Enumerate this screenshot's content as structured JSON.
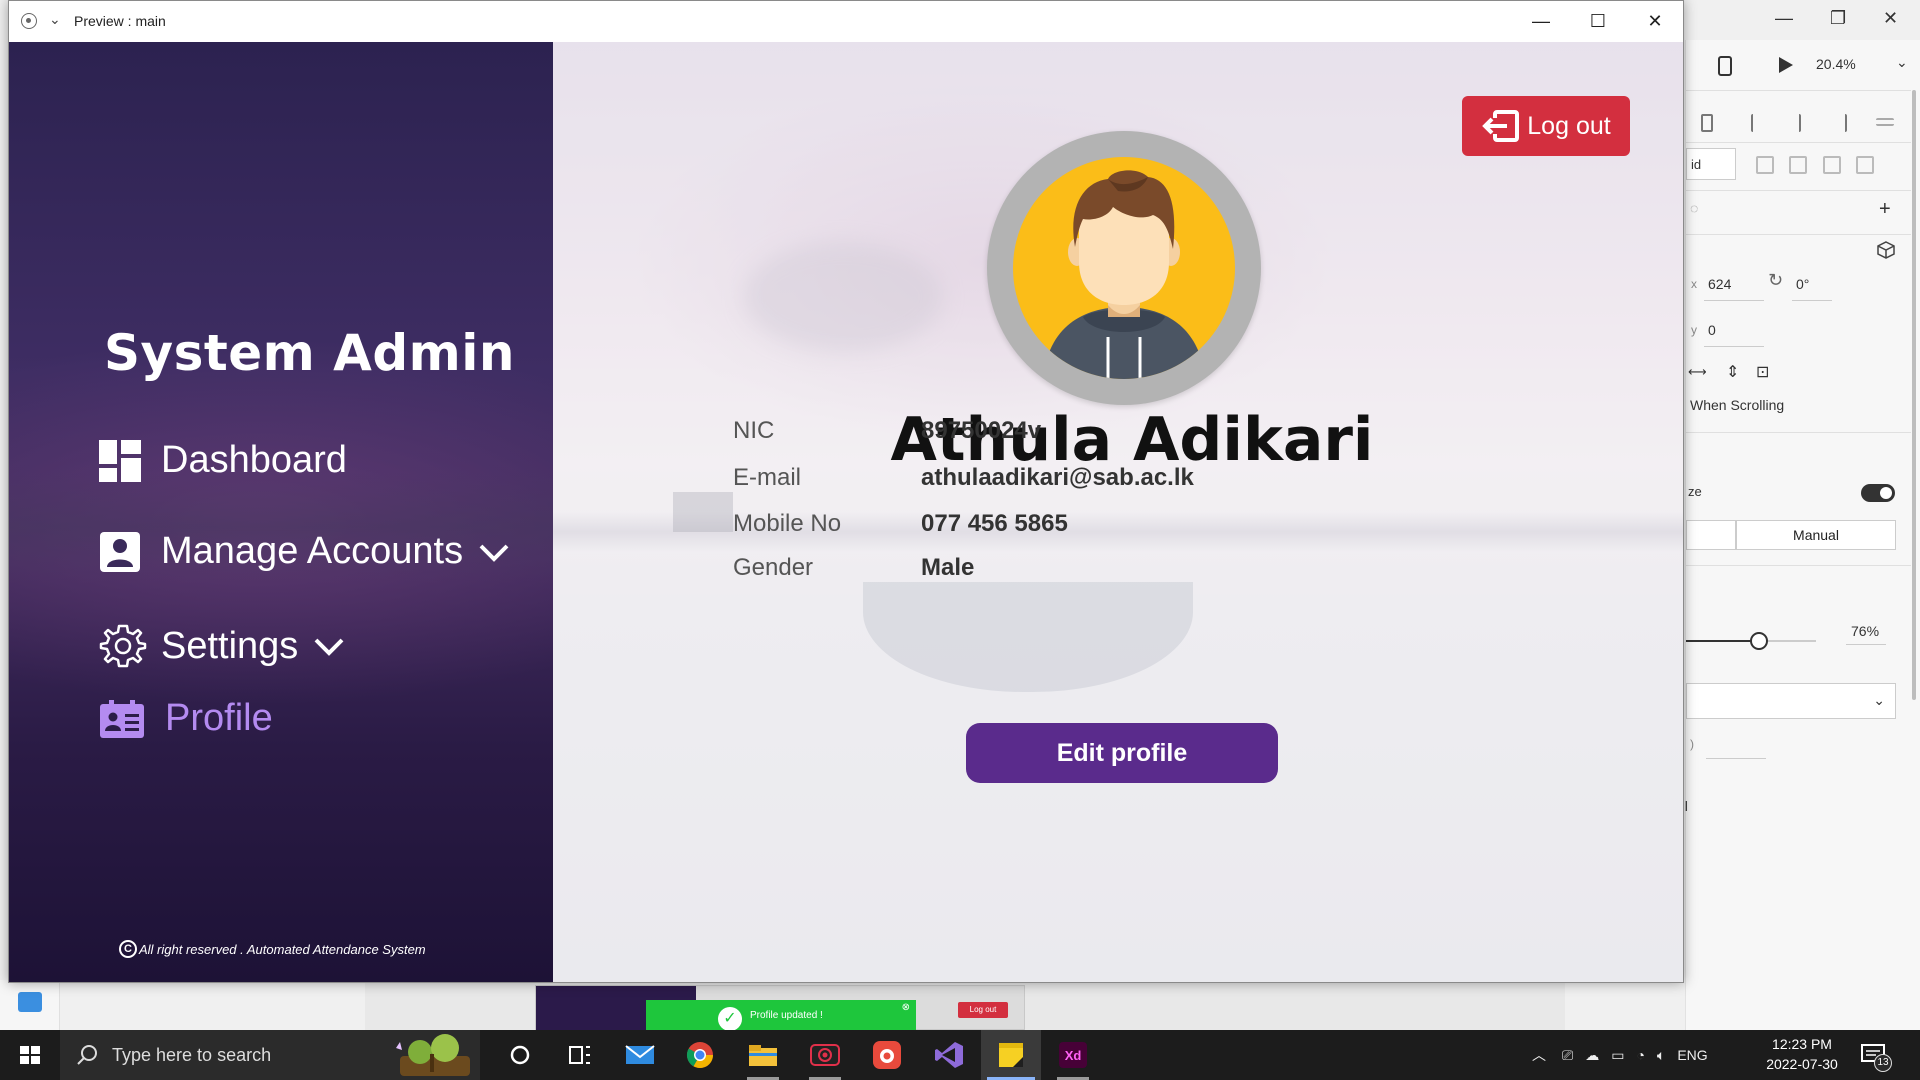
{
  "preview_window": {
    "title": "Preview : main",
    "controls": {
      "minimize": "—",
      "maximize": "☐",
      "close": "✕"
    }
  },
  "sidebar": {
    "title": "System Admin",
    "items": [
      {
        "label": "Dashboard",
        "icon": "dashboard-icon",
        "has_chevron": false,
        "active": false
      },
      {
        "label": "Manage Accounts",
        "icon": "user-card-icon",
        "has_chevron": true,
        "active": false
      },
      {
        "label": "Settings",
        "icon": "gear-icon",
        "has_chevron": true,
        "active": false
      },
      {
        "label": "Profile",
        "icon": "id-card-icon",
        "has_chevron": false,
        "active": true
      }
    ],
    "copyright": "All right reserved . Automated Attendance System"
  },
  "main": {
    "logout_label": "Log out",
    "user_name": "Athula Adikari",
    "fields": [
      {
        "label": "NIC",
        "value": "89750024v"
      },
      {
        "label": "E-mail",
        "value": "athulaadikari@sab.ac.lk"
      },
      {
        "label": "Mobile No",
        "value": "077 456 5865"
      },
      {
        "label": "Gender",
        "value": "Male"
      }
    ],
    "edit_label": "Edit profile"
  },
  "xd_panel": {
    "zoom": "20.4%",
    "x_value": "624",
    "rotation": "0°",
    "y_value": "0",
    "when_scrolling": "When Scrolling",
    "resize_label_partial": "ze",
    "manual": "Manual",
    "opacity": "76%",
    "fill": "Fill",
    "grid_partial": "id",
    "opacity_level": 0.76
  },
  "xd_thumbnail": {
    "toast": "Profile updated !",
    "logout": "Log out"
  },
  "taskbar": {
    "search_placeholder": "Type here to search",
    "language": "ENG",
    "time": "12:23 PM",
    "date": "2022-07-30",
    "notifications": "13"
  },
  "colors": {
    "logout": "#d32f3f",
    "edit": "#5a2b8c",
    "active_nav": "#b48bf0",
    "avatar_bg": "#fbbd18"
  }
}
